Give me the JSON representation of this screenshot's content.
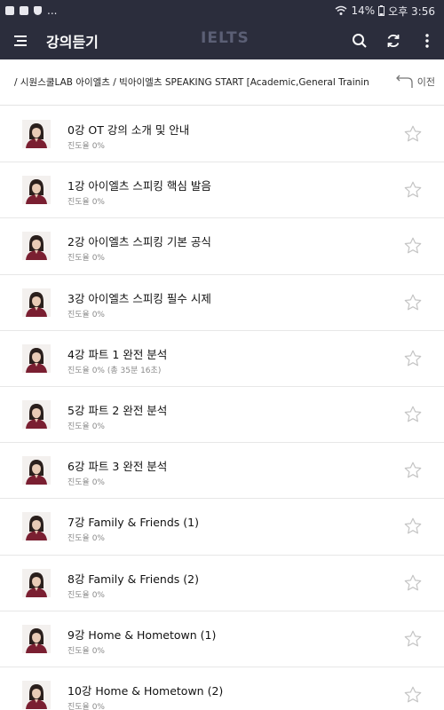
{
  "status_bar": {
    "left_more": "...",
    "battery_percent": "14%",
    "time": "오후 3:56"
  },
  "app_bar": {
    "title": "강의듣기",
    "brand": "IELTS",
    "icons": [
      "menu-icon",
      "search-icon",
      "refresh-icon",
      "more-vert-icon"
    ]
  },
  "breadcrumb": {
    "path": "/ 시원스쿨LAB 아이엘츠 / 빅아이엘츠 SPEAKING START [Academic,General Training]",
    "back_label": "이전"
  },
  "lectures": [
    {
      "title": "0강 OT 강의 소개 및 안내",
      "progress": "진도율 0%",
      "favorite": false
    },
    {
      "title": "1강 아이엘츠 스피킹 핵심 발음",
      "progress": "진도율 0%",
      "favorite": false
    },
    {
      "title": "2강 아이엘츠 스피킹 기본 공식",
      "progress": "진도율 0%",
      "favorite": false
    },
    {
      "title": "3강 아이엘츠 스피킹 필수 시제",
      "progress": "진도율 0%",
      "favorite": false
    },
    {
      "title": "4강 파트 1 완전 분석",
      "progress": "진도율 0% (총 35분 16초)",
      "favorite": false
    },
    {
      "title": "5강 파트 2 완전 분석",
      "progress": "진도율 0%",
      "favorite": false
    },
    {
      "title": "6강 파트 3 완전 분석",
      "progress": "진도율 0%",
      "favorite": false
    },
    {
      "title": "7강 Family & Friends (1)",
      "progress": "진도율 0%",
      "favorite": false
    },
    {
      "title": "8강 Family & Friends (2)",
      "progress": "진도율 0%",
      "favorite": false
    },
    {
      "title": "9강 Home & Hometown (1)",
      "progress": "진도율 0%",
      "favorite": false
    },
    {
      "title": "10강 Home & Hometown (2)",
      "progress": "진도율 0%",
      "favorite": false
    }
  ],
  "colors": {
    "app_bar_bg": "#2b2d3c",
    "brand_text": "#5b5f75",
    "star_outline": "#c4c4c4"
  }
}
